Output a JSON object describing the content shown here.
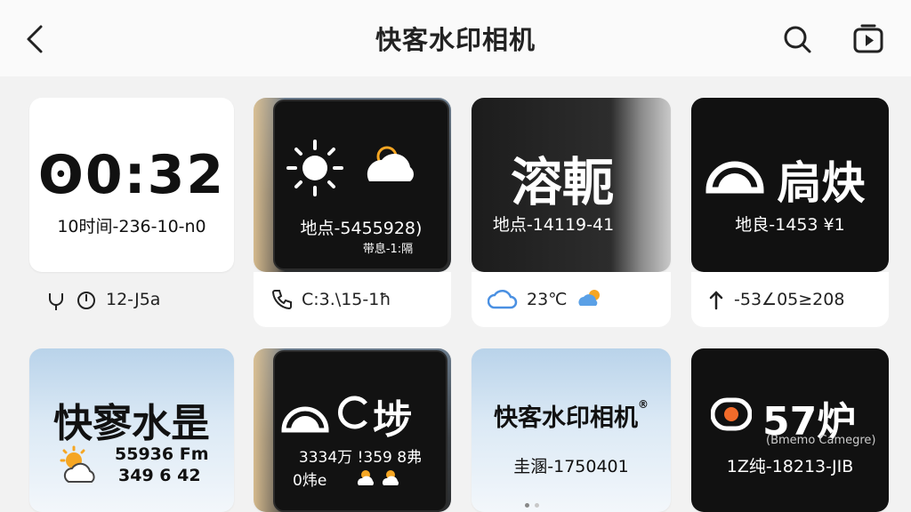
{
  "header": {
    "title": "快客水印相机"
  },
  "cards": [
    {
      "main": "ʘ0:32",
      "sub": "10时间-236-10-n0",
      "footer": "12-J5a"
    },
    {
      "sub1": "地点-5455928)",
      "sub2": "带息-1:隔",
      "footer": "C:3.\\15-1ħ"
    },
    {
      "main": "溶軛",
      "sub": "地点-14119-41",
      "footer": "23℃"
    },
    {
      "main": "扃炔",
      "sub": "地良-1453 ¥1",
      "footer": "-53∠05≥208"
    },
    {
      "main": "快寥水昰",
      "sub1": "55936 Fm",
      "sub2": "349 6 42"
    },
    {
      "main": "埗",
      "sub1": "3334万 !359 8弗",
      "sub2": "0炜e"
    },
    {
      "main": "快客水印相机",
      "mark": "®",
      "sub": "圭溷-1750401"
    },
    {
      "main": "57炉",
      "sub1": "(Bmemo Camegre)",
      "sub2": "1Z纯-18213-JIB"
    }
  ],
  "colors": {
    "accent_blue": "#4a90e2",
    "sun_orange": "#f5a623",
    "text_dark": "#222222"
  }
}
